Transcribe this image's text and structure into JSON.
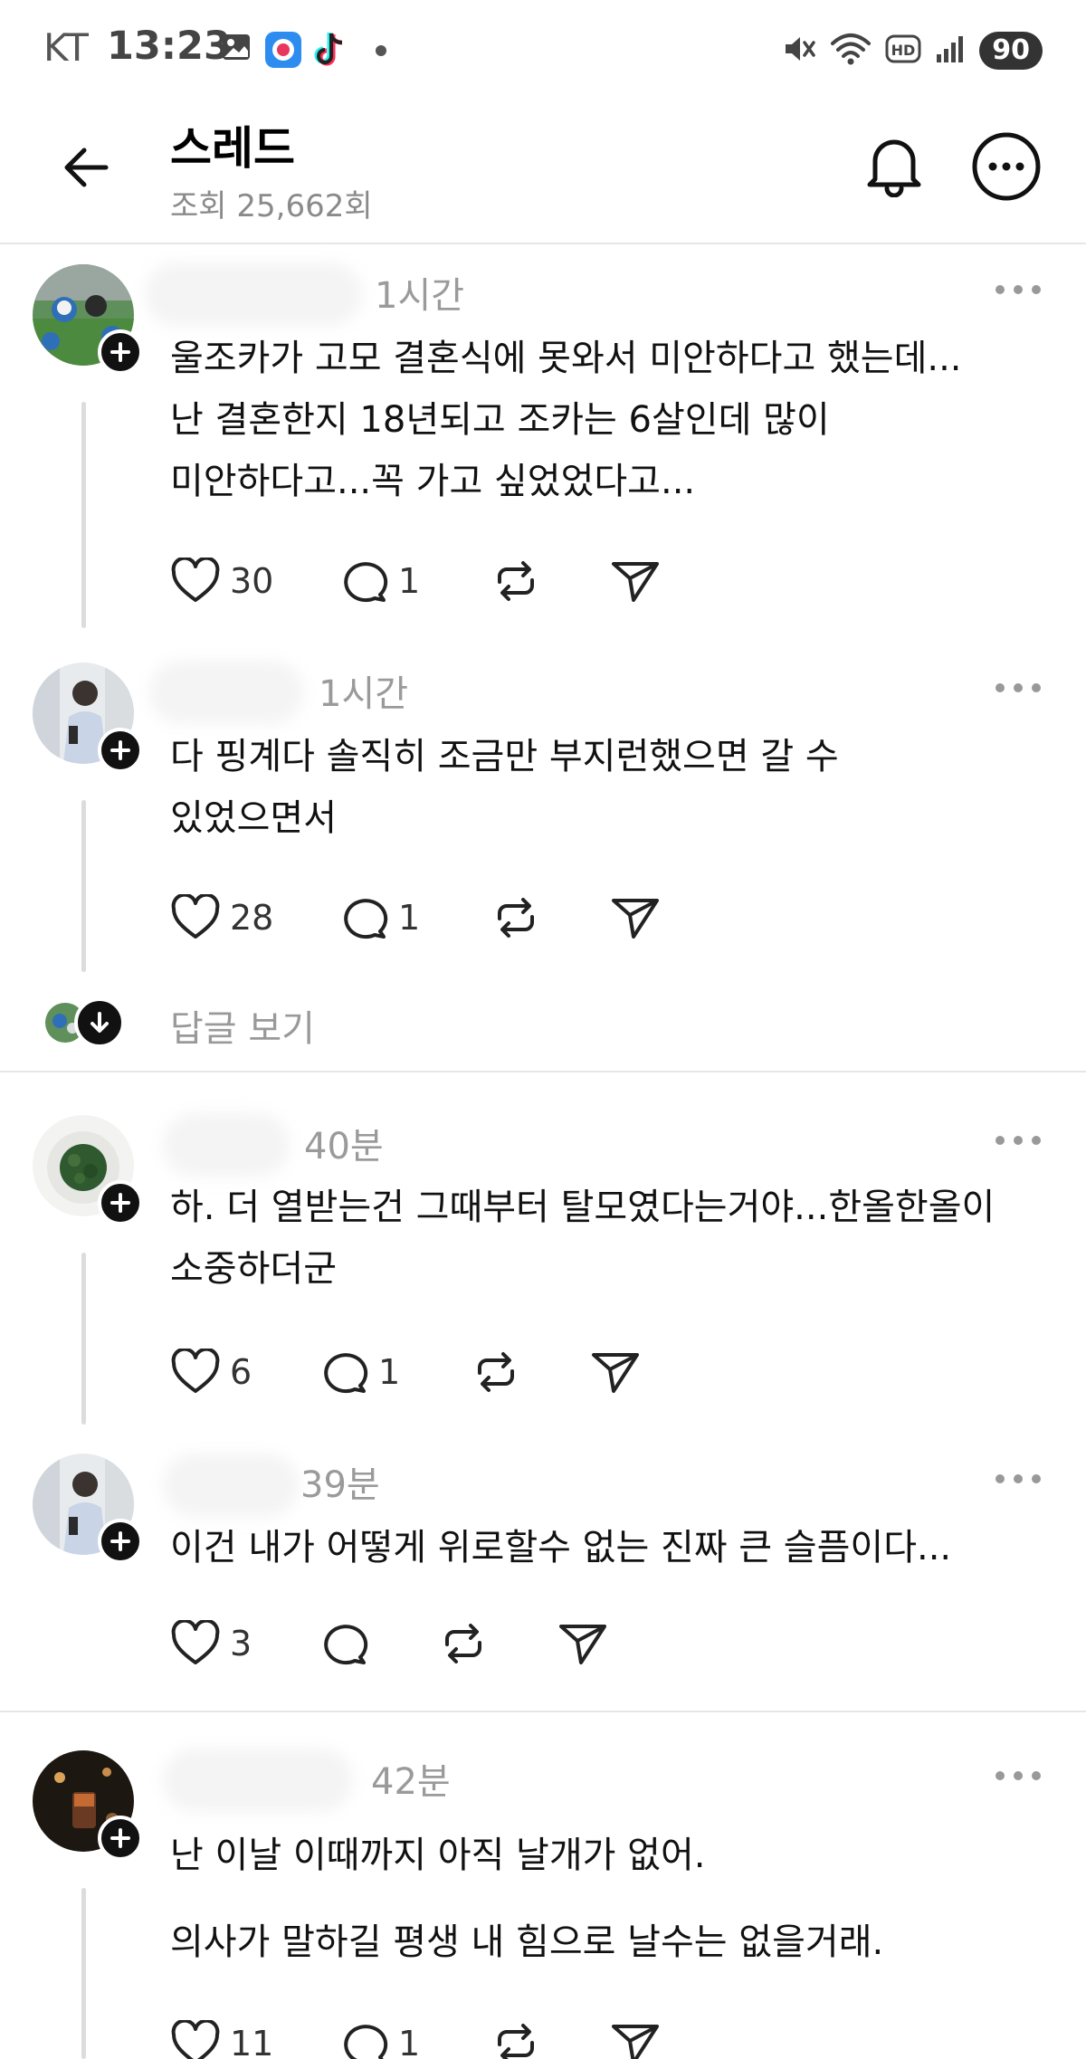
{
  "status_bar": {
    "carrier": "KT",
    "time": "13:23",
    "battery": "90",
    "left_icons": [
      "gallery-icon",
      "app-icon",
      "tiktok-icon",
      "dot-icon"
    ],
    "right_icons": [
      "mute-icon",
      "wifi-icon",
      "hd-icon",
      "signal-icon"
    ]
  },
  "header": {
    "title": "스레드",
    "views": "조회 25,662회"
  },
  "posts": [
    {
      "time": "1시간",
      "text_lines": [
        "울조카가 고모 결혼식에 못와서 미안하다고 했는데...",
        "난 결혼한지 18년되고 조카는 6살인데 많이",
        "미안하다고...꼭 가고  싶었었다고..."
      ],
      "likes": "30",
      "replies": "1"
    },
    {
      "time": "1시간",
      "text_lines": [
        "다 핑계다 솔직히 조금만 부지런했으면 갈 수",
        "있었으면서"
      ],
      "likes": "28",
      "replies": "1"
    },
    {
      "time": "40분",
      "text_lines": [
        "하. 더 열받는건 그때부터 탈모였다는거야...한올한올이",
        "소중하더군"
      ],
      "likes": "6",
      "replies": "1"
    },
    {
      "time": "39분",
      "text_lines": [
        "이건 내가 어떻게 위로할수 없는 진짜 큰 슬픔이다..."
      ],
      "likes": "3",
      "replies": ""
    },
    {
      "time": "42분",
      "text_lines": [
        "난 이날 이때까지 아직 날개가 없어.",
        "의사가 말하길 평생 내 힘으로 날수는 없을거래."
      ],
      "likes": "11",
      "replies": "1"
    }
  ],
  "show_replies_label": "답글 보기",
  "colors": {
    "text": "#111111",
    "muted": "#9a9a9a",
    "divider": "#e6e6e6",
    "thread_line": "#dcdcdc"
  }
}
